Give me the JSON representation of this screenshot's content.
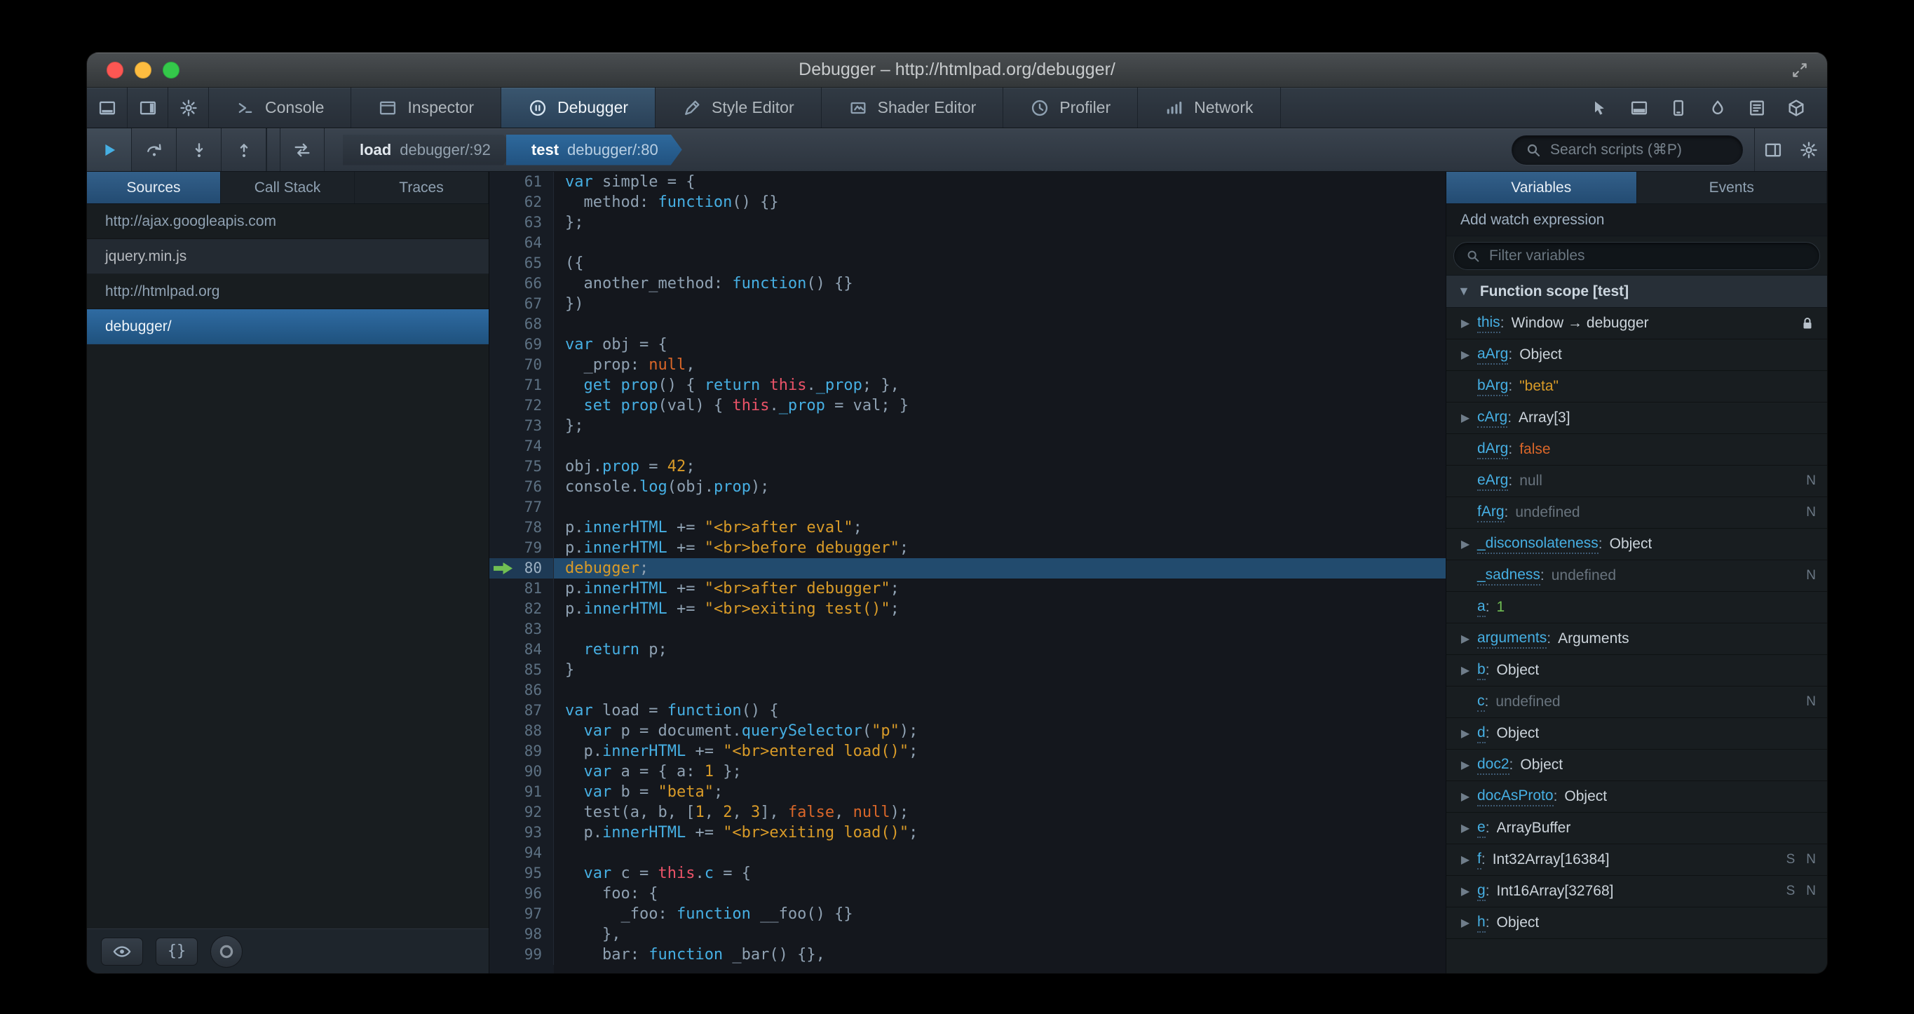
{
  "window": {
    "title": "Debugger – http://htmlpad.org/debugger/"
  },
  "toolbox": {
    "left_icons": [
      "dock-bottom-icon",
      "dock-side-icon",
      "toolbox-options-icon"
    ],
    "tabs": [
      {
        "label": "Console",
        "icon": "console-icon",
        "active": false
      },
      {
        "label": "Inspector",
        "icon": "inspector-icon",
        "active": false
      },
      {
        "label": "Debugger",
        "icon": "debugger-icon",
        "active": true
      },
      {
        "label": "Style Editor",
        "icon": "style-editor-icon",
        "active": false
      },
      {
        "label": "Shader Editor",
        "icon": "shader-editor-icon",
        "active": false
      },
      {
        "label": "Profiler",
        "icon": "profiler-icon",
        "active": false
      },
      {
        "label": "Network",
        "icon": "network-icon",
        "active": false
      }
    ],
    "right_icons": [
      "pick-element-icon",
      "split-console-icon",
      "responsive-design-icon",
      "paint-flashing-icon",
      "scratchpad-icon",
      "tilt-icon"
    ]
  },
  "debugger_toolbar": {
    "breadcrumbs": [
      {
        "fn": "load",
        "location": "debugger/:92",
        "active": false
      },
      {
        "fn": "test",
        "location": "debugger/:80",
        "active": true
      }
    ],
    "search_placeholder": "Search scripts (⌘P)"
  },
  "sources_panel": {
    "tabs": [
      {
        "label": "Sources",
        "active": true
      },
      {
        "label": "Call Stack",
        "active": false
      },
      {
        "label": "Traces",
        "active": false
      }
    ],
    "items": [
      {
        "label": "http://ajax.googleapis.com",
        "type": "group",
        "selected": false
      },
      {
        "label": "jquery.min.js",
        "type": "source",
        "selected": false
      },
      {
        "label": "http://htmlpad.org",
        "type": "group",
        "selected": false
      },
      {
        "label": "debugger/",
        "type": "source",
        "selected": true
      }
    ]
  },
  "editor": {
    "first_line": 61,
    "highlight_line": 80,
    "lines": [
      {
        "n": 61,
        "t": [
          [
            "kw",
            "var"
          ],
          [
            "",
            " simple = {"
          ]
        ]
      },
      {
        "n": 62,
        "t": [
          [
            "",
            "  method: "
          ],
          [
            "kw",
            "function"
          ],
          [
            "",
            "() {}"
          ]
        ]
      },
      {
        "n": 63,
        "t": [
          [
            "",
            "};"
          ]
        ]
      },
      {
        "n": 64,
        "t": []
      },
      {
        "n": 65,
        "t": [
          [
            "",
            "({"
          ]
        ]
      },
      {
        "n": 66,
        "t": [
          [
            "",
            "  another_method: "
          ],
          [
            "kw",
            "function"
          ],
          [
            "",
            "() {}"
          ]
        ]
      },
      {
        "n": 67,
        "t": [
          [
            "",
            "})"
          ]
        ]
      },
      {
        "n": 68,
        "t": []
      },
      {
        "n": 69,
        "t": [
          [
            "kw",
            "var"
          ],
          [
            "",
            " obj = {"
          ]
        ]
      },
      {
        "n": 70,
        "t": [
          [
            "",
            "  _prop: "
          ],
          [
            "at",
            "null"
          ],
          [
            "",
            ","
          ]
        ]
      },
      {
        "n": 71,
        "t": [
          [
            "",
            "  "
          ],
          [
            "kw",
            "get"
          ],
          [
            "",
            " "
          ],
          [
            "pr",
            "prop"
          ],
          [
            "",
            "() { "
          ],
          [
            "kw",
            "return"
          ],
          [
            "",
            " "
          ],
          [
            "th",
            "this"
          ],
          [
            "",
            "."
          ],
          [
            "pr",
            "_prop"
          ],
          [
            "",
            "; },"
          ]
        ]
      },
      {
        "n": 72,
        "t": [
          [
            "",
            "  "
          ],
          [
            "kw",
            "set"
          ],
          [
            "",
            " "
          ],
          [
            "pr",
            "prop"
          ],
          [
            "",
            "(val) { "
          ],
          [
            "th",
            "this"
          ],
          [
            "",
            "."
          ],
          [
            "pr",
            "_prop"
          ],
          [
            "",
            " = val; }"
          ]
        ]
      },
      {
        "n": 73,
        "t": [
          [
            "",
            "};"
          ]
        ]
      },
      {
        "n": 74,
        "t": []
      },
      {
        "n": 75,
        "t": [
          [
            "",
            "obj."
          ],
          [
            "pr",
            "prop"
          ],
          [
            "",
            " = "
          ],
          [
            "nu",
            "42"
          ],
          [
            "",
            ";"
          ]
        ]
      },
      {
        "n": 76,
        "t": [
          [
            "",
            "console."
          ],
          [
            "pr",
            "log"
          ],
          [
            "",
            "(obj."
          ],
          [
            "pr",
            "prop"
          ],
          [
            "",
            ");"
          ]
        ]
      },
      {
        "n": 77,
        "t": []
      },
      {
        "n": 78,
        "t": [
          [
            "",
            "p."
          ],
          [
            "pr",
            "innerHTML"
          ],
          [
            "",
            " += "
          ],
          [
            "st",
            "\"<br>after eval\""
          ],
          [
            "",
            ";"
          ]
        ]
      },
      {
        "n": 79,
        "t": [
          [
            "",
            "p."
          ],
          [
            "pr",
            "innerHTML"
          ],
          [
            "",
            " += "
          ],
          [
            "st",
            "\"<br>before debugger\""
          ],
          [
            "",
            ";"
          ]
        ]
      },
      {
        "n": 80,
        "t": [
          [
            "dbg",
            "debugger"
          ],
          [
            "",
            ";"
          ]
        ]
      },
      {
        "n": 81,
        "t": [
          [
            "",
            "p."
          ],
          [
            "pr",
            "innerHTML"
          ],
          [
            "",
            " += "
          ],
          [
            "st",
            "\"<br>after debugger\""
          ],
          [
            "",
            ";"
          ]
        ]
      },
      {
        "n": 82,
        "t": [
          [
            "",
            "p."
          ],
          [
            "pr",
            "innerHTML"
          ],
          [
            "",
            " += "
          ],
          [
            "st",
            "\"<br>exiting test()\""
          ],
          [
            "",
            ";"
          ]
        ]
      },
      {
        "n": 83,
        "t": []
      },
      {
        "n": 84,
        "t": [
          [
            "",
            "  "
          ],
          [
            "kw",
            "return"
          ],
          [
            "",
            " p;"
          ]
        ]
      },
      {
        "n": 85,
        "t": [
          [
            "",
            "}"
          ]
        ]
      },
      {
        "n": 86,
        "t": []
      },
      {
        "n": 87,
        "t": [
          [
            "kw",
            "var"
          ],
          [
            "",
            " load = "
          ],
          [
            "kw",
            "function"
          ],
          [
            "",
            "() {"
          ]
        ]
      },
      {
        "n": 88,
        "t": [
          [
            "",
            "  "
          ],
          [
            "kw",
            "var"
          ],
          [
            "",
            " p = document."
          ],
          [
            "pr",
            "querySelector"
          ],
          [
            "",
            "("
          ],
          [
            "st",
            "\"p\""
          ],
          [
            "",
            ");"
          ]
        ]
      },
      {
        "n": 89,
        "t": [
          [
            "",
            "  p."
          ],
          [
            "pr",
            "innerHTML"
          ],
          [
            "",
            " += "
          ],
          [
            "st",
            "\"<br>entered load()\""
          ],
          [
            "",
            ";"
          ]
        ]
      },
      {
        "n": 90,
        "t": [
          [
            "",
            "  "
          ],
          [
            "kw",
            "var"
          ],
          [
            "",
            " a = { a: "
          ],
          [
            "nu",
            "1"
          ],
          [
            "",
            " };"
          ]
        ]
      },
      {
        "n": 91,
        "t": [
          [
            "",
            "  "
          ],
          [
            "kw",
            "var"
          ],
          [
            "",
            " b = "
          ],
          [
            "st",
            "\"beta\""
          ],
          [
            "",
            ";"
          ]
        ]
      },
      {
        "n": 92,
        "t": [
          [
            "",
            "  test(a, b, ["
          ],
          [
            "nu",
            "1"
          ],
          [
            "",
            ", "
          ],
          [
            "nu",
            "2"
          ],
          [
            "",
            ", "
          ],
          [
            "nu",
            "3"
          ],
          [
            "",
            "], "
          ],
          [
            "at",
            "false"
          ],
          [
            "",
            ", "
          ],
          [
            "at",
            "null"
          ],
          [
            "",
            ");"
          ]
        ]
      },
      {
        "n": 93,
        "t": [
          [
            "",
            "  p."
          ],
          [
            "pr",
            "innerHTML"
          ],
          [
            "",
            " += "
          ],
          [
            "st",
            "\"<br>exiting load()\""
          ],
          [
            "",
            ";"
          ]
        ]
      },
      {
        "n": 94,
        "t": []
      },
      {
        "n": 95,
        "t": [
          [
            "",
            "  "
          ],
          [
            "kw",
            "var"
          ],
          [
            "",
            " c = "
          ],
          [
            "th",
            "this"
          ],
          [
            "",
            "."
          ],
          [
            "pr",
            "c"
          ],
          [
            "",
            " = {"
          ]
        ]
      },
      {
        "n": 96,
        "t": [
          [
            "",
            "    foo: {"
          ]
        ]
      },
      {
        "n": 97,
        "t": [
          [
            "",
            "      _foo: "
          ],
          [
            "kw",
            "function"
          ],
          [
            "",
            " __foo() {}"
          ]
        ]
      },
      {
        "n": 98,
        "t": [
          [
            "",
            "    },"
          ]
        ]
      },
      {
        "n": 99,
        "t": [
          [
            "",
            "    bar: "
          ],
          [
            "kw",
            "function"
          ],
          [
            "",
            " _bar() {},"
          ]
        ]
      }
    ]
  },
  "variables_panel": {
    "tabs": [
      {
        "label": "Variables",
        "active": true
      },
      {
        "label": "Events",
        "active": false
      }
    ],
    "watch_label": "Add watch expression",
    "filter_placeholder": "Filter variables",
    "scope": "Function scope [test]",
    "separator": ":",
    "variables": [
      {
        "name": "this",
        "value": "Window → debugger",
        "type": "obj",
        "expandable": true,
        "lock": true
      },
      {
        "name": "aArg",
        "value": "Object",
        "type": "obj",
        "expandable": true
      },
      {
        "name": "bArg",
        "value": "\"beta\"",
        "type": "str",
        "expandable": false
      },
      {
        "name": "cArg",
        "value": "Array[3]",
        "type": "obj",
        "expandable": true
      },
      {
        "name": "dArg",
        "value": "false",
        "type": "bool",
        "expandable": false
      },
      {
        "name": "eArg",
        "value": "null",
        "type": "dim",
        "expandable": false,
        "badges": [
          "N"
        ]
      },
      {
        "name": "fArg",
        "value": "undefined",
        "type": "dim",
        "expandable": false,
        "badges": [
          "N"
        ]
      },
      {
        "name": "_disconsolateness",
        "value": "Object",
        "type": "obj",
        "expandable": true
      },
      {
        "name": "_sadness",
        "value": "undefined",
        "type": "dim",
        "expandable": false,
        "badges": [
          "N"
        ]
      },
      {
        "name": "a",
        "value": "1",
        "type": "num",
        "expandable": false
      },
      {
        "name": "arguments",
        "value": "Arguments",
        "type": "obj",
        "expandable": true
      },
      {
        "name": "b",
        "value": "Object",
        "type": "obj",
        "expandable": true
      },
      {
        "name": "c",
        "value": "undefined",
        "type": "dim",
        "expandable": false,
        "badges": [
          "N"
        ]
      },
      {
        "name": "d",
        "value": "Object",
        "type": "obj",
        "expandable": true
      },
      {
        "name": "doc2",
        "value": "Object",
        "type": "obj",
        "expandable": true
      },
      {
        "name": "docAsProto",
        "value": "Object",
        "type": "obj",
        "expandable": true
      },
      {
        "name": "e",
        "value": "ArrayBuffer",
        "type": "obj",
        "expandable": true
      },
      {
        "name": "f",
        "value": "Int32Array[16384]",
        "type": "obj",
        "expandable": true,
        "badges": [
          "S",
          "N"
        ]
      },
      {
        "name": "g",
        "value": "Int16Array[32768]",
        "type": "obj",
        "expandable": true,
        "badges": [
          "S",
          "N"
        ]
      },
      {
        "name": "h",
        "value": "Object",
        "type": "obj",
        "expandable": true
      }
    ]
  },
  "colors": {
    "accent_blue": "#46afe3",
    "selection_blue": "#1d4f73",
    "background_dark": "#14171a",
    "panel_background": "#181d20",
    "toolbar_background": "#343c45",
    "text_primary": "#b6babf",
    "text_dim": "#8fa1b2",
    "string_orange": "#d99b28",
    "atom_red": "#d96629",
    "number_green": "#70bf53",
    "breakpoint_green": "#70bf53",
    "traffic_red": "#fc5753",
    "traffic_yellow": "#fdbc40",
    "traffic_green": "#34c84a"
  }
}
